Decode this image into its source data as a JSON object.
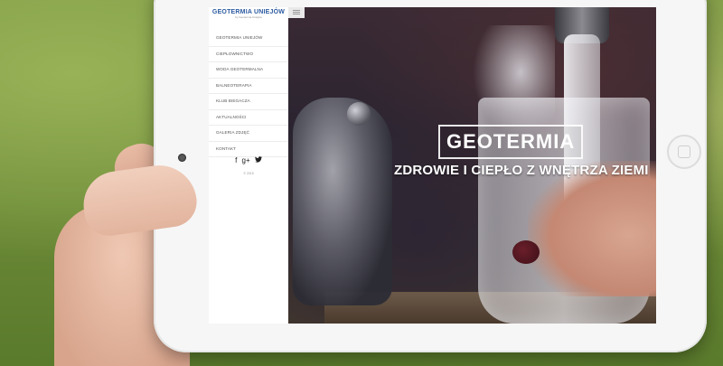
{
  "site": {
    "logo_title": "GEOTERMIA UNIEJÓW",
    "logo_subtitle": "by Geotermia Uniejów"
  },
  "sidebar": {
    "items": [
      {
        "label": "GEOTERMIA UNIEJÓW"
      },
      {
        "label": "CIEPŁOWNICTWO"
      },
      {
        "label": "WODA GEOTERMALNA"
      },
      {
        "label": "BALNEOTERAPIA"
      },
      {
        "label": "KLUB BIEGACZA"
      },
      {
        "label": "AKTUALNOŚCI"
      },
      {
        "label": "GALERIA ZDJĘĆ"
      },
      {
        "label": "KONTAKT"
      }
    ],
    "social": {
      "facebook": "f",
      "google_plus": "g+",
      "twitter": "🐦"
    },
    "copyright": "© 2015"
  },
  "hero": {
    "title": "GEOTERMIA",
    "subtitle": "ZDROWIE I CIEPŁO Z WNĘTRZA ZIEMI"
  },
  "colors": {
    "logo_blue": "#2c5aa0",
    "tablet_white": "#f6f6f6"
  }
}
